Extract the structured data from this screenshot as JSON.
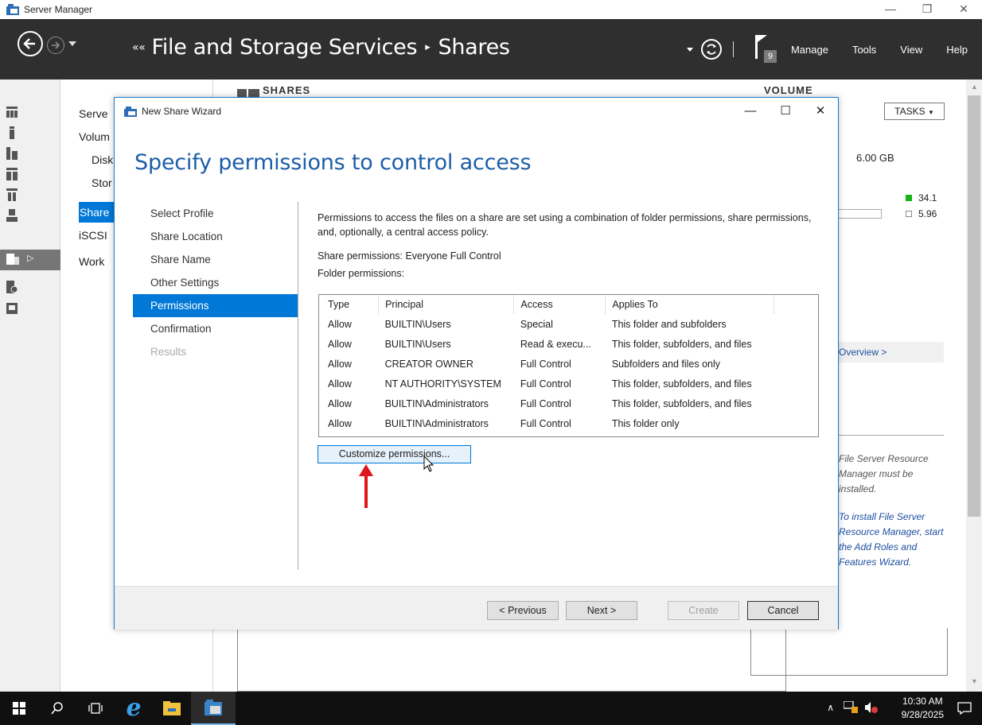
{
  "server_manager": {
    "title": "Server Manager",
    "window_controls": [
      "—",
      "❐",
      "✕"
    ]
  },
  "header": {
    "breadcrumb_lead": "««",
    "breadcrumb_root": "File and Storage Services",
    "breadcrumb_sep": "▸",
    "breadcrumb_leaf": "Shares",
    "notification_count": "9",
    "menu": [
      "Manage",
      "Tools",
      "View",
      "Help"
    ]
  },
  "nav": {
    "items": [
      "Serve",
      "Volum",
      "Disk",
      "Stor",
      "Share",
      "iSCSI",
      "Work"
    ]
  },
  "background": {
    "shares_title": "SHARES",
    "volume_title": "VOLUME",
    "tasks_label": "TASKS",
    "size": "6.00 GB",
    "legend": [
      "34.1",
      "5.96"
    ],
    "overview_link": "Overview >",
    "note1": "File Server Resource Manager must be installed.",
    "note2": "To install File Server Resource Manager, start the Add Roles and Features Wizard."
  },
  "wizard": {
    "title": "New Share Wizard",
    "heading": "Specify permissions to control access",
    "steps": [
      {
        "label": "Select Profile",
        "state": "normal"
      },
      {
        "label": "Share Location",
        "state": "normal"
      },
      {
        "label": "Share Name",
        "state": "normal"
      },
      {
        "label": "Other Settings",
        "state": "normal"
      },
      {
        "label": "Permissions",
        "state": "active"
      },
      {
        "label": "Confirmation",
        "state": "normal"
      },
      {
        "label": "Results",
        "state": "disabled"
      }
    ],
    "description": "Permissions to access the files on a share are set using a combination of folder permissions, share permissions, and, optionally, a central access policy.",
    "share_permissions": "Share permissions: Everyone Full Control",
    "folder_permissions_label": "Folder permissions:",
    "table": {
      "headers": [
        "Type",
        "Principal",
        "Access",
        "Applies To"
      ],
      "rows": [
        [
          "Allow",
          "BUILTIN\\Users",
          "Special",
          "This folder and subfolders"
        ],
        [
          "Allow",
          "BUILTIN\\Users",
          "Read & execu...",
          "This folder, subfolders, and files"
        ],
        [
          "Allow",
          "CREATOR OWNER",
          "Full Control",
          "Subfolders and files only"
        ],
        [
          "Allow",
          "NT AUTHORITY\\SYSTEM",
          "Full Control",
          "This folder, subfolders, and files"
        ],
        [
          "Allow",
          "BUILTIN\\Administrators",
          "Full Control",
          "This folder, subfolders, and files"
        ],
        [
          "Allow",
          "BUILTIN\\Administrators",
          "Full Control",
          "This folder only"
        ]
      ]
    },
    "customize_button": "Customize permissions...",
    "buttons": {
      "previous": "< Previous",
      "next": "Next >",
      "create": "Create",
      "cancel": "Cancel"
    },
    "window_controls": [
      "—",
      "☐",
      "✕"
    ]
  },
  "taskbar": {
    "time": "10:30 AM",
    "date": "9/28/2025"
  },
  "colors": {
    "accent": "#0078d7",
    "header_bg": "#2f2f2f",
    "heading_blue": "#1c5ea8",
    "annotation_arrow": "#e0141b"
  }
}
